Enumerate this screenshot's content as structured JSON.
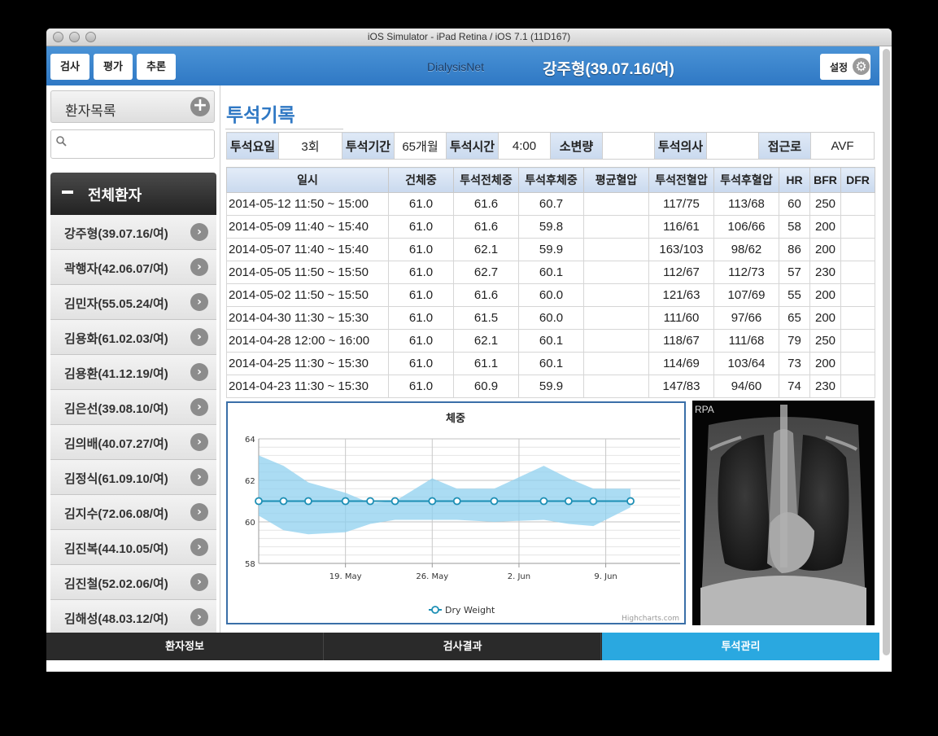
{
  "window": {
    "title": "iOS Simulator - iPad Retina / iOS 7.1 (11D167)"
  },
  "topbar": {
    "buttons": [
      "검사",
      "평가",
      "추론"
    ],
    "brand": "DialysisNet",
    "patient": "강주형(39.07.16/여)",
    "settings_label": "설정"
  },
  "sidebar": {
    "header": "환자목록",
    "search_placeholder": "",
    "group_label": "전체환자",
    "patients": [
      "강주형(39.07.16/여)",
      "곽행자(42.06.07/여)",
      "김민자(55.05.24/여)",
      "김용화(61.02.03/여)",
      "김용환(41.12.19/여)",
      "김은선(39.08.10/여)",
      "김의배(40.07.27/여)",
      "김정식(61.09.10/여)",
      "김지수(72.06.08/여)",
      "김진복(44.10.05/여)",
      "김진철(52.02.06/여)",
      "김해성(48.03.12/여)"
    ]
  },
  "main": {
    "title": "투석기록",
    "summary": [
      {
        "key": "투석요일",
        "value": "3회"
      },
      {
        "key": "투석기간",
        "value": "65개월"
      },
      {
        "key": "투석시간",
        "value": "4:00"
      },
      {
        "key": "소변량",
        "value": ""
      },
      {
        "key": "투석의사",
        "value": ""
      },
      {
        "key": "접근로",
        "value": "AVF"
      }
    ],
    "columns": [
      "일시",
      "건체중",
      "투석전체중",
      "투석후체중",
      "평균혈압",
      "투석전혈압",
      "투석후혈압",
      "HR",
      "BFR",
      "DFR"
    ],
    "rows": [
      [
        "2014-05-12 11:50 ~ 15:00",
        "61.0",
        "61.6",
        "60.7",
        "",
        "117/75",
        "113/68",
        "60",
        "250",
        ""
      ],
      [
        "2014-05-09 11:40 ~ 15:40",
        "61.0",
        "61.6",
        "59.8",
        "",
        "116/61",
        "106/66",
        "58",
        "200",
        ""
      ],
      [
        "2014-05-07 11:40 ~ 15:40",
        "61.0",
        "62.1",
        "59.9",
        "",
        "163/103",
        "98/62",
        "86",
        "200",
        ""
      ],
      [
        "2014-05-05 11:50 ~ 15:50",
        "61.0",
        "62.7",
        "60.1",
        "",
        "112/67",
        "112/73",
        "57",
        "230",
        ""
      ],
      [
        "2014-05-02 11:50 ~ 15:50",
        "61.0",
        "61.6",
        "60.0",
        "",
        "121/63",
        "107/69",
        "55",
        "200",
        ""
      ],
      [
        "2014-04-30 11:30 ~ 15:30",
        "61.0",
        "61.5",
        "60.0",
        "",
        "111/60",
        "97/66",
        "65",
        "200",
        ""
      ],
      [
        "2014-04-28 12:00 ~ 16:00",
        "61.0",
        "62.1",
        "60.1",
        "",
        "118/67",
        "111/68",
        "79",
        "250",
        ""
      ],
      [
        "2014-04-25 11:30 ~ 15:30",
        "61.0",
        "61.1",
        "60.1",
        "",
        "114/69",
        "103/64",
        "73",
        "200",
        ""
      ],
      [
        "2014-04-23 11:30 ~ 15:30",
        "61.0",
        "60.9",
        "59.9",
        "",
        "147/83",
        "94/60",
        "74",
        "230",
        ""
      ]
    ],
    "xray_label": "RPA"
  },
  "chart_data": {
    "type": "line",
    "title": "체중",
    "xlabel": "",
    "ylabel": "",
    "ylim": [
      58,
      64
    ],
    "yticks": [
      58,
      60,
      62,
      64
    ],
    "xlim": [
      "2014-05-12",
      "2014-06-15"
    ],
    "xticks": [
      {
        "value": "2014-05-19",
        "label": "19. May"
      },
      {
        "value": "2014-05-26",
        "label": "26. May"
      },
      {
        "value": "2014-06-02",
        "label": "2. Jun"
      },
      {
        "value": "2014-06-09",
        "label": "9. Jun"
      }
    ],
    "series": [
      {
        "name": "Dry Weight",
        "type": "line",
        "color": "#1d8fb5",
        "points": [
          {
            "x": "2014-05-12",
            "y": 61.0
          },
          {
            "x": "2014-05-14",
            "y": 61.0
          },
          {
            "x": "2014-05-16",
            "y": 61.0
          },
          {
            "x": "2014-05-19",
            "y": 61.0
          },
          {
            "x": "2014-05-21",
            "y": 61.0
          },
          {
            "x": "2014-05-23",
            "y": 61.0
          },
          {
            "x": "2014-05-26",
            "y": 61.0
          },
          {
            "x": "2014-05-28",
            "y": 61.0
          },
          {
            "x": "2014-05-31",
            "y": 61.0
          },
          {
            "x": "2014-06-04",
            "y": 61.0
          },
          {
            "x": "2014-06-06",
            "y": 61.0
          },
          {
            "x": "2014-06-08",
            "y": 61.0
          },
          {
            "x": "2014-06-11",
            "y": 61.0
          }
        ]
      },
      {
        "type": "arearange",
        "color": "#8fd0ef",
        "points": [
          {
            "x": "2014-05-12",
            "low": 60.3,
            "high": 63.2
          },
          {
            "x": "2014-05-14",
            "low": 59.6,
            "high": 62.7
          },
          {
            "x": "2014-05-16",
            "low": 59.4,
            "high": 61.9
          },
          {
            "x": "2014-05-19",
            "low": 59.5,
            "high": 61.4
          },
          {
            "x": "2014-05-21",
            "low": 59.9,
            "high": 60.9
          },
          {
            "x": "2014-05-23",
            "low": 60.1,
            "high": 61.0
          },
          {
            "x": "2014-05-26",
            "low": 60.1,
            "high": 62.1
          },
          {
            "x": "2014-05-28",
            "low": 60.1,
            "high": 61.6
          },
          {
            "x": "2014-05-31",
            "low": 60.0,
            "high": 61.6
          },
          {
            "x": "2014-06-04",
            "low": 60.1,
            "high": 62.7
          },
          {
            "x": "2014-06-06",
            "low": 59.9,
            "high": 62.1
          },
          {
            "x": "2014-06-08",
            "low": 59.8,
            "high": 61.6
          },
          {
            "x": "2014-06-11",
            "low": 60.7,
            "high": 61.6
          }
        ]
      }
    ],
    "legend": "bottom",
    "credit": "Highcharts.com",
    "grid": true
  },
  "tabs": [
    {
      "label": "환자정보",
      "active": false
    },
    {
      "label": "검사결과",
      "active": false
    },
    {
      "label": "투석관리",
      "active": true
    }
  ]
}
